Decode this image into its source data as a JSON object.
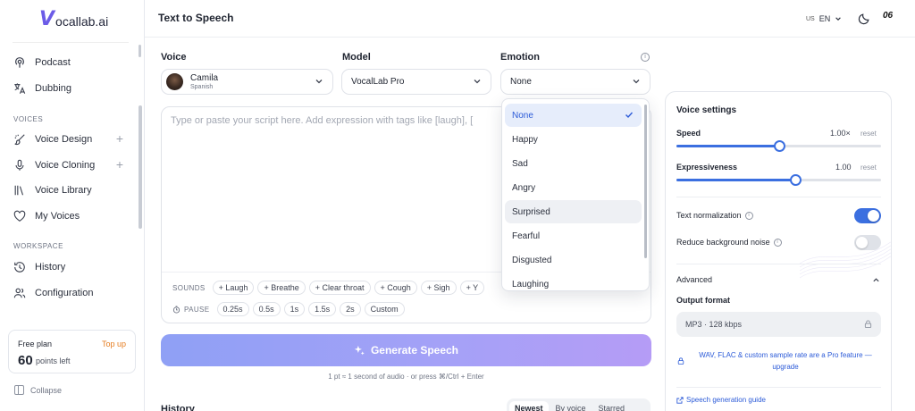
{
  "brand": {
    "logo_v": "V",
    "logo_rest": "ocallab.ai"
  },
  "sidebar": {
    "items_top": [
      {
        "label": "Podcast",
        "icon": "podcast-icon"
      },
      {
        "label": "Dubbing",
        "icon": "translate-icon"
      }
    ],
    "voices_section": "VOICES",
    "voices_items": [
      {
        "label": "Voice Design",
        "icon": "brush-icon",
        "plus": "+"
      },
      {
        "label": "Voice Cloning",
        "icon": "microphone-icon",
        "plus": "+"
      },
      {
        "label": "Voice Library",
        "icon": "library-icon"
      },
      {
        "label": "My Voices",
        "icon": "heart-icon"
      }
    ],
    "workspace_section": "WORKSPACE",
    "workspace_items": [
      {
        "label": "History",
        "icon": "history-icon"
      },
      {
        "label": "Configuration",
        "icon": "users-icon"
      }
    ],
    "plan": {
      "label": "Free plan",
      "topup": "Top up",
      "points": "60",
      "points_label": "points left"
    },
    "collapse": "Collapse"
  },
  "header": {
    "title": "Text to Speech",
    "lang_flag": "US",
    "lang_code": "EN",
    "avatar": "06"
  },
  "form": {
    "voice_label": "Voice",
    "voice_name": "Camila",
    "voice_sub": "Spanish",
    "model_label": "Model",
    "model_value": "VocalLab Pro",
    "emotion_label": "Emotion",
    "emotion_value": "None",
    "info": "i"
  },
  "editor": {
    "placeholder": "Type or paste your script here. Add expression with tags like [laugh], [",
    "sounds_label": "SOUNDS",
    "sounds": [
      "+ Laugh",
      "+ Breathe",
      "+ Clear throat",
      "+ Cough",
      "+ Sigh",
      "+ Y"
    ],
    "pause_label": "PAUSE",
    "pauses": [
      "0.25s",
      "0.5s",
      "1s",
      "1.5s",
      "2s",
      "Custom"
    ]
  },
  "generate": {
    "label": "Generate Speech",
    "note": "1 pt ≈ 1 second of audio · or press ⌘/Ctrl + Enter"
  },
  "history": {
    "title": "History",
    "tabs": [
      "Newest",
      "By voice",
      "Starred"
    ],
    "active_tab": "Newest"
  },
  "emotion_dropdown": {
    "options": [
      "None",
      "Happy",
      "Sad",
      "Angry",
      "Surprised",
      "Fearful",
      "Disgusted",
      "Laughing"
    ],
    "selected": "None",
    "hovered": "Surprised"
  },
  "settings": {
    "title": "Voice settings",
    "speed_label": "Speed",
    "speed_value": "1.00×",
    "speed_level": 0.5,
    "expressiveness_label": "Expressiveness",
    "expressiveness_value": "1.00",
    "expressiveness_level": 0.58,
    "reset": "reset",
    "text_norm_label": "Text normalization",
    "text_norm_on": true,
    "noise_label": "Reduce background noise",
    "noise_on": false,
    "advanced_label": "Advanced",
    "output_label": "Output format",
    "output_value": "MP3 · 128 kbps",
    "pro_note": "WAV, FLAC & custom sample rate are a Pro feature — upgrade",
    "guide_link": "Speech generation guide"
  },
  "colors": {
    "accent": "#3b6fe0",
    "brand": "#6c5ce7",
    "topup": "#e67e22"
  }
}
